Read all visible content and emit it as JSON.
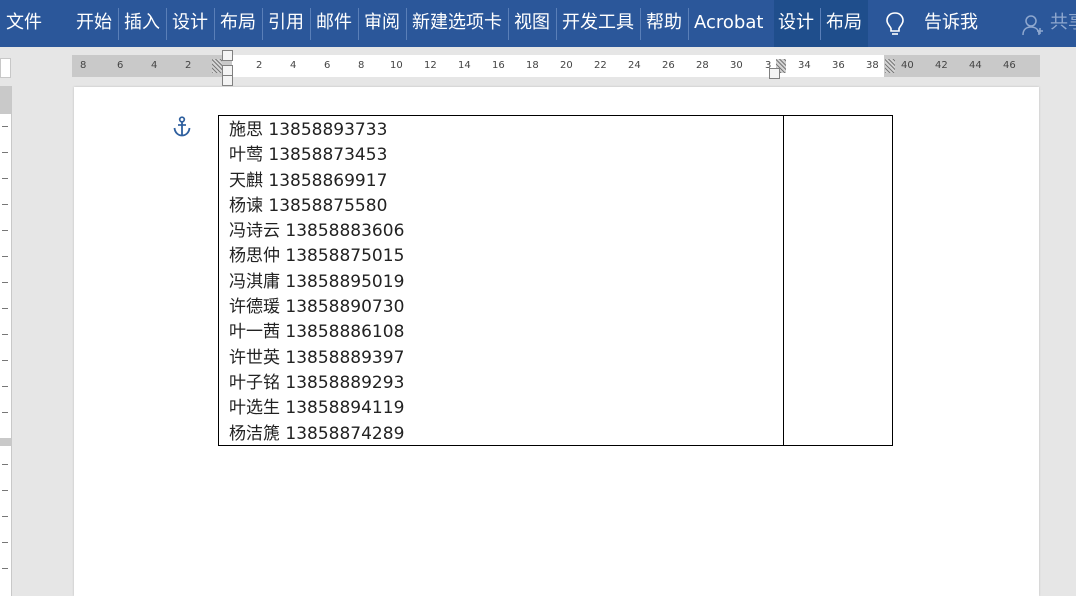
{
  "ribbon": {
    "tabs": [
      "文件",
      "开始",
      "插入",
      "设计",
      "布局",
      "引用",
      "邮件",
      "审阅",
      "新建选项卡",
      "视图",
      "开发工具",
      "帮助",
      "Acrobat"
    ],
    "context_tabs": [
      "设计",
      "布局"
    ],
    "tell_me": "告诉我",
    "share": "共享"
  },
  "ruler": {
    "numbers": [
      "8",
      "6",
      "4",
      "2",
      "2",
      "4",
      "6",
      "8",
      "10",
      "12",
      "14",
      "16",
      "18",
      "20",
      "22",
      "24",
      "26",
      "28",
      "30",
      "3",
      "34",
      "36",
      "38",
      "40",
      "42",
      "44",
      "46"
    ]
  },
  "document": {
    "table_rows": [
      "施思 13858893733",
      "叶莺 13858873453",
      "天麒 13858869917",
      "杨谏 13858875580",
      "冯诗云 13858883606",
      "杨思仲 13858875015",
      "冯淇庸 13858895019",
      "许德瑗 13858890730",
      "叶一茜 13858886108",
      "许世英 13858889397",
      "叶子铭 13858889293",
      "叶选生 13858894119",
      "杨洁篪 13858874289"
    ]
  },
  "colors": {
    "ribbon": "#2b579a",
    "ribbon_context": "#1f4e8c",
    "page": "#ffffff",
    "canvas": "#e6e6e6"
  }
}
